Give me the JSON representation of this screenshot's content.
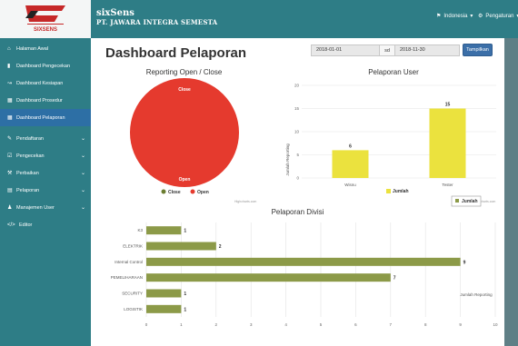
{
  "header": {
    "app_name": "sixSens",
    "company": "PT. JAWARA INTEGRA SEMESTA",
    "language_menu": "Indonesia",
    "settings_menu": "Pengaturan"
  },
  "logo_text": "SIXSENS",
  "sidebar": {
    "items": [
      {
        "label": "Halaman Awal",
        "icon": "home-icon",
        "chevron": false
      },
      {
        "label": "Dashboard Pengecekan",
        "icon": "bar-chart-icon",
        "chevron": false
      },
      {
        "label": "Dashboard Kesiapan",
        "icon": "line-chart-icon",
        "chevron": false
      },
      {
        "label": "Dashboard Prosedur",
        "icon": "table-icon",
        "chevron": false
      },
      {
        "label": "Dashboard Pelaporan",
        "icon": "table-icon",
        "chevron": false,
        "active": true
      },
      {
        "label": "Pendaftaran",
        "icon": "edit-icon",
        "chevron": true
      },
      {
        "label": "Pengecekan",
        "icon": "check-icon",
        "chevron": true
      },
      {
        "label": "Perbaikan",
        "icon": "wrench-icon",
        "chevron": true
      },
      {
        "label": "Pelaporan",
        "icon": "report-icon",
        "chevron": true
      },
      {
        "label": "Manajemen User",
        "icon": "user-icon",
        "chevron": true
      },
      {
        "label": "Editor",
        "icon": "code-icon",
        "chevron": false
      }
    ]
  },
  "main": {
    "title": "Dashboard Pelaporan",
    "date_from": "2018-01-01",
    "date_sep": "sd",
    "date_to": "2018-11-30",
    "show_button": "Tampilkan",
    "credit": "Highcharts.com"
  },
  "chart_data": [
    {
      "type": "pie",
      "title": "Reporting Open / Close",
      "labels": [
        "Close",
        "Open"
      ],
      "values": [
        0,
        100
      ],
      "slice_labels": [
        "Close",
        "Open"
      ],
      "colors": [
        "#6b7d31",
        "#e53a2e"
      ],
      "legend": [
        "Close",
        "Open"
      ],
      "legend_position": "bottom"
    },
    {
      "type": "bar",
      "title": "Pelaporan User",
      "categories": [
        "Wisnu",
        "Tester"
      ],
      "values": [
        6,
        15
      ],
      "ylabel": "Jumlah Reporting",
      "ylim": [
        0,
        20
      ],
      "yticks": [
        0,
        5,
        10,
        15,
        20
      ],
      "color": "#ebe23e",
      "legend": [
        "Jumlah"
      ],
      "legend_position": "bottom"
    },
    {
      "type": "bar",
      "orientation": "horizontal",
      "title": "Pelaporan Divisi",
      "categories": [
        "K3",
        "ELEKTRIK",
        "Internal Control",
        "PEMELIHARAAN",
        "SECURITY",
        "LOGISTIK"
      ],
      "values": [
        1,
        2,
        9,
        7,
        1,
        1
      ],
      "xlabel": "Jumlah Reporting",
      "xlim": [
        0,
        10
      ],
      "xticks": [
        0,
        1,
        2,
        3,
        4,
        5,
        6,
        7,
        8,
        9,
        10
      ],
      "color": "#8c9a48",
      "legend": [
        "Jumlah"
      ],
      "legend_position": "top-right"
    }
  ]
}
